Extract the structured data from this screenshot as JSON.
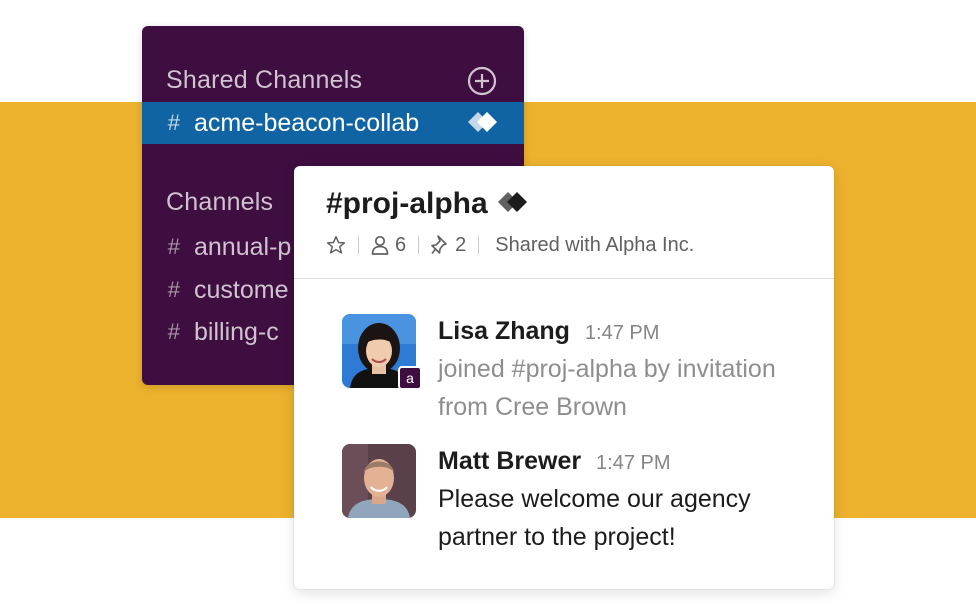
{
  "sidebar": {
    "shared_header": "Shared Channels",
    "channels_header": "Channels",
    "shared_channels": [
      {
        "name": "acme-beacon-collab",
        "active": true
      }
    ],
    "channels": [
      {
        "name": "annual-p"
      },
      {
        "name": "custome"
      },
      {
        "name": "billing-c"
      }
    ],
    "colors": {
      "background": "#3F0E40",
      "active": "#1164A3"
    }
  },
  "panel": {
    "title": "#proj-alpha",
    "members_count": "6",
    "pinned_count": "2",
    "shared_with": "Shared with Alpha Inc."
  },
  "messages": [
    {
      "author": "Lisa Zhang",
      "time": "1:47 PM",
      "text": "joined #proj-alpha by invitation from Cree Brown",
      "system": true,
      "badge": "a"
    },
    {
      "author": "Matt Brewer",
      "time": "1:47 PM",
      "text": "Please welcome our agency partner to the project!",
      "system": false
    }
  ],
  "icons": [
    "add-channel-icon",
    "shared-channel-icon",
    "star-icon",
    "members-icon",
    "pin-icon"
  ],
  "accent": "#ECB22E"
}
